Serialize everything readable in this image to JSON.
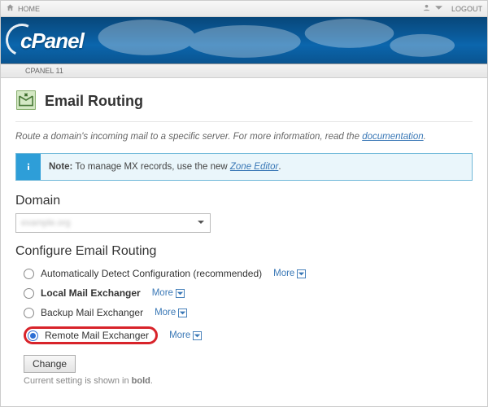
{
  "topbar": {
    "home": "HOME",
    "logout": "LOGOUT"
  },
  "banner": {
    "logo_text": "cPanel"
  },
  "breadcrumb": {
    "text": "CPANEL 11"
  },
  "page": {
    "title": "Email Routing",
    "intro_prefix": "Route a domain's incoming mail to a specific server. For more information, read the ",
    "intro_link": "documentation",
    "intro_suffix": "."
  },
  "note": {
    "bold": "Note:",
    "text": " To manage MX records, use the new ",
    "link": "Zone Editor",
    "suffix": "."
  },
  "domain": {
    "heading": "Domain",
    "selected": "example.org"
  },
  "configure": {
    "heading": "Configure Email Routing",
    "options": [
      {
        "label": "Automatically Detect Configuration (recommended)",
        "bold": false,
        "selected": false
      },
      {
        "label": "Local Mail Exchanger",
        "bold": true,
        "selected": false
      },
      {
        "label": "Backup Mail Exchanger",
        "bold": false,
        "selected": false
      },
      {
        "label": "Remote Mail Exchanger",
        "bold": false,
        "selected": true
      }
    ],
    "more_label": "More",
    "change_button": "Change",
    "hint_prefix": "Current setting is shown in ",
    "hint_bold": "bold",
    "hint_suffix": "."
  }
}
